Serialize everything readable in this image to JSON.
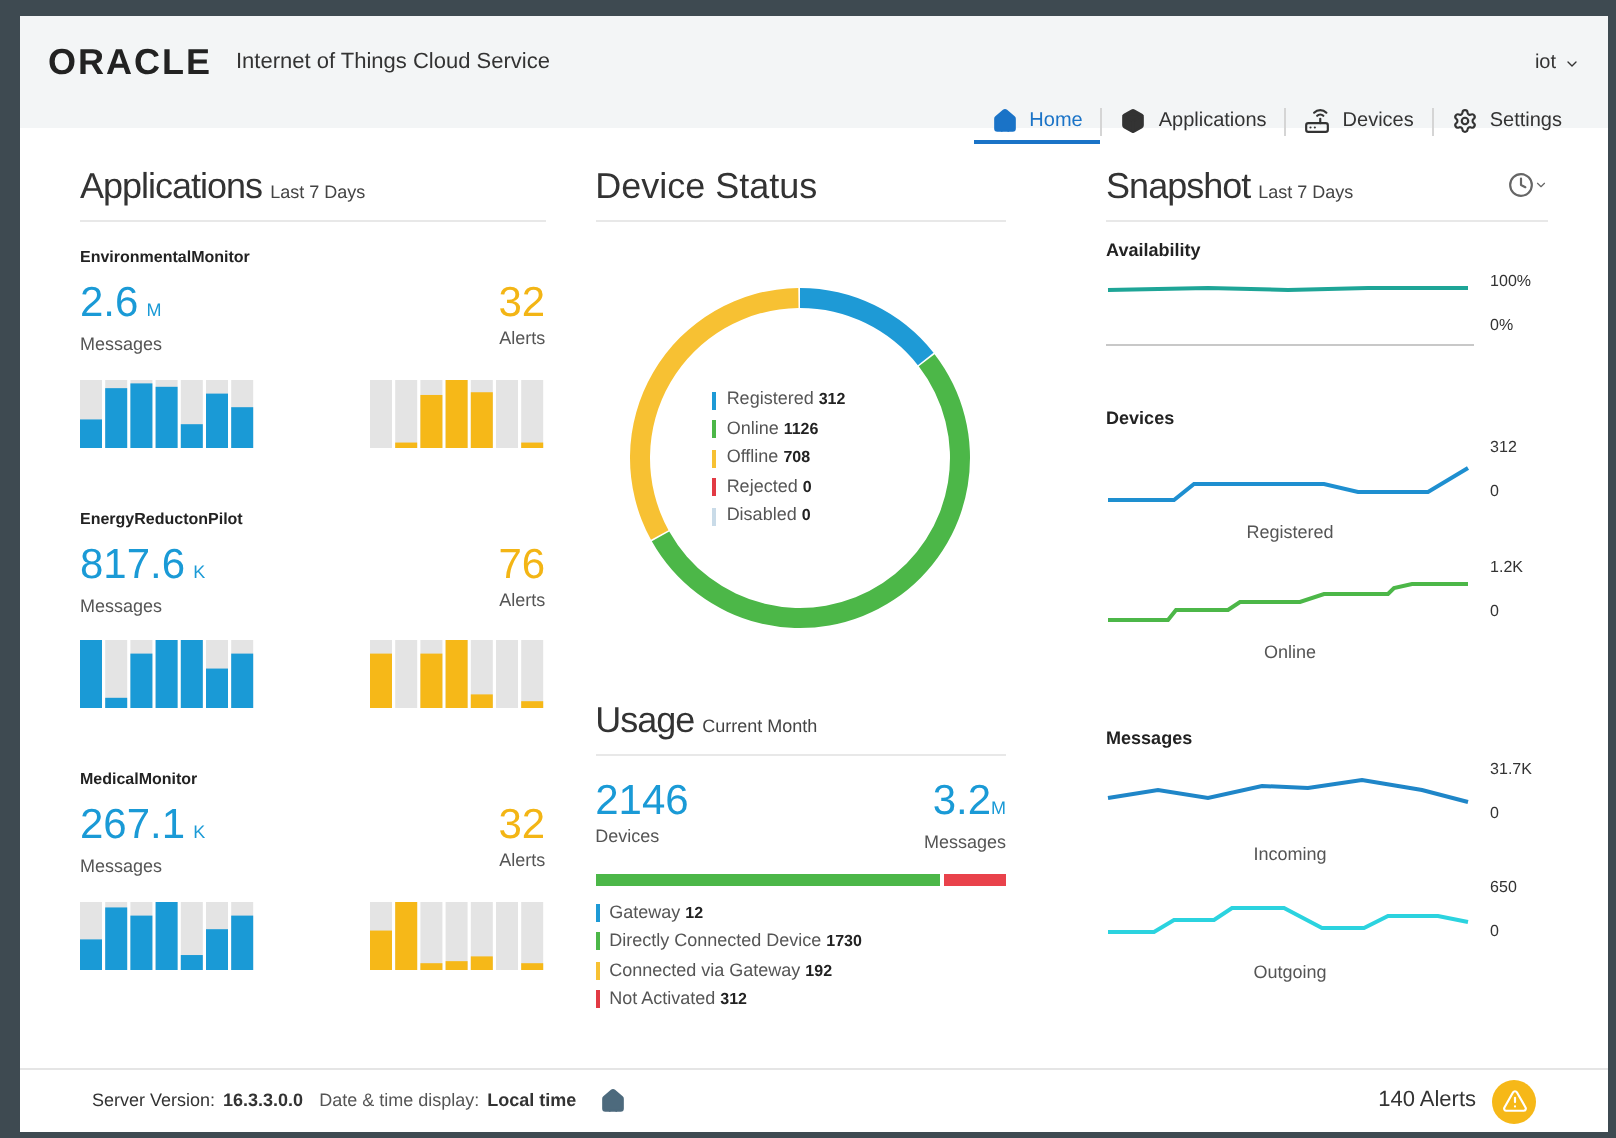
{
  "header": {
    "logo": "ORACLE",
    "product": "Internet of Things Cloud Service",
    "user": "iot"
  },
  "nav": [
    {
      "label": "Home",
      "kind": "home",
      "selected": true
    },
    {
      "label": "Applications",
      "kind": "cube",
      "selected": false
    },
    {
      "label": "Devices",
      "kind": "device",
      "selected": false
    },
    {
      "label": "Settings",
      "kind": "gear",
      "selected": false
    }
  ],
  "applications": {
    "title": "Applications",
    "subtitle": "Last 7 Days",
    "items": [
      {
        "name": "EnvironmentalMonitor",
        "messages": "2.6",
        "messages_unit": "M",
        "messages_label": "Messages",
        "alerts": "32",
        "alerts_label": "Alerts"
      },
      {
        "name": "EnergyReductonPilot",
        "messages": "817.6",
        "messages_unit": "K",
        "messages_label": "Messages",
        "alerts": "76",
        "alerts_label": "Alerts"
      },
      {
        "name": "MedicalMonitor",
        "messages": "267.1",
        "messages_unit": "K",
        "messages_label": "Messages",
        "alerts": "32",
        "alerts_label": "Alerts"
      }
    ]
  },
  "device_status": {
    "title": "Device Status",
    "legend": [
      {
        "label": "Registered",
        "value": "312",
        "color": "#1e9ad6"
      },
      {
        "label": "Online",
        "value": "1126",
        "color": "#4cb748"
      },
      {
        "label": "Offline",
        "value": "708",
        "color": "#f7c133"
      },
      {
        "label": "Rejected",
        "value": "0",
        "color": "#e23a44"
      },
      {
        "label": "Disabled",
        "value": "0",
        "color": "#c9dbe8"
      }
    ]
  },
  "usage": {
    "title": "Usage",
    "subtitle": "Current Month",
    "devices": "2146",
    "devices_label": "Devices",
    "messages": "3.2",
    "messages_unit": "M",
    "messages_label": "Messages",
    "bar": {
      "level": 0.85
    },
    "legend": [
      {
        "label": "Gateway",
        "value": "12",
        "color": "#1e9ad6"
      },
      {
        "label": "Directly Connected Device",
        "value": "1730",
        "color": "#4cb748"
      },
      {
        "label": "Connected via Gateway",
        "value": "192",
        "color": "#f7c133"
      },
      {
        "label": "Not Activated",
        "value": "312",
        "color": "#e23a44"
      }
    ]
  },
  "snapshot": {
    "title": "Snapshot",
    "subtitle": "Last 7 Days",
    "sections": [
      {
        "title": "Availability",
        "charts": [
          {
            "kind": "availability",
            "max": "100%",
            "min": "0%"
          }
        ]
      },
      {
        "title": "Devices",
        "charts": [
          {
            "kind": "registered",
            "label": "Registered",
            "max": "312",
            "min": "0"
          },
          {
            "kind": "online",
            "label": "Online",
            "max": "1.2K",
            "min": "0"
          }
        ]
      },
      {
        "title": "Messages",
        "charts": [
          {
            "kind": "incoming",
            "label": "Incoming",
            "max": "31.7K",
            "min": "0"
          },
          {
            "kind": "outgoing",
            "label": "Outgoing",
            "max": "650",
            "min": "0"
          }
        ]
      }
    ]
  },
  "footer": {
    "server_label": "Server Version:",
    "server_version": "16.3.3.0.0",
    "time_label": "Date & time display:",
    "time_value": "Local time",
    "alerts": "140 Alerts"
  }
}
